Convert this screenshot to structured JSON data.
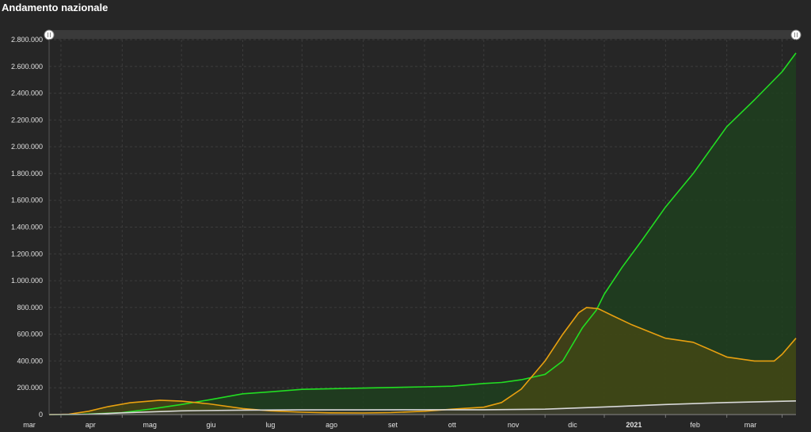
{
  "title": "Andamento nazionale",
  "chart_data": {
    "type": "area",
    "title": "Andamento nazionale",
    "xlabel": "",
    "ylabel": "",
    "x_start": "2020-02-24",
    "x_end": "2021-03-08",
    "ylim": [
      0,
      2800000
    ],
    "y_ticks": [
      0,
      200000,
      400000,
      600000,
      800000,
      1000000,
      1200000,
      1400000,
      1600000,
      1800000,
      2000000,
      2200000,
      2400000,
      2600000,
      2800000
    ],
    "y_tick_labels": [
      "0",
      "200.000",
      "400.000",
      "600.000",
      "800.000",
      "1.000.000",
      "1.200.000",
      "1.400.000",
      "1.600.000",
      "1.800.000",
      "2.000.000",
      "2.200.000",
      "2.400.000",
      "2.600.000",
      "2.800.000"
    ],
    "x_ticks": [
      {
        "date": "2020-03-01",
        "label": "mar",
        "bold": false
      },
      {
        "date": "2020-04-01",
        "label": "apr",
        "bold": false
      },
      {
        "date": "2020-05-01",
        "label": "mag",
        "bold": false
      },
      {
        "date": "2020-06-01",
        "label": "giu",
        "bold": false
      },
      {
        "date": "2020-07-01",
        "label": "lug",
        "bold": false
      },
      {
        "date": "2020-08-01",
        "label": "ago",
        "bold": false
      },
      {
        "date": "2020-09-01",
        "label": "set",
        "bold": false
      },
      {
        "date": "2020-10-01",
        "label": "ott",
        "bold": false
      },
      {
        "date": "2020-11-01",
        "label": "nov",
        "bold": false
      },
      {
        "date": "2020-12-01",
        "label": "dic",
        "bold": false
      },
      {
        "date": "2021-01-01",
        "label": "2021",
        "bold": true
      },
      {
        "date": "2021-02-01",
        "label": "feb",
        "bold": false
      },
      {
        "date": "2021-03-01",
        "label": "mar",
        "bold": false
      }
    ],
    "grid": true,
    "series": [
      {
        "color": "#22dd22",
        "fill": "#1f3f1f",
        "points": [
          [
            "2020-02-24",
            0
          ],
          [
            "2020-03-10",
            1000
          ],
          [
            "2020-03-25",
            10000
          ],
          [
            "2020-04-01",
            15000
          ],
          [
            "2020-04-15",
            40000
          ],
          [
            "2020-05-01",
            75000
          ],
          [
            "2020-05-15",
            110000
          ],
          [
            "2020-06-01",
            155000
          ],
          [
            "2020-06-15",
            170000
          ],
          [
            "2020-07-01",
            188000
          ],
          [
            "2020-08-01",
            198000
          ],
          [
            "2020-09-01",
            207000
          ],
          [
            "2020-09-15",
            212000
          ],
          [
            "2020-10-01",
            232000
          ],
          [
            "2020-10-10",
            240000
          ],
          [
            "2020-10-20",
            260000
          ],
          [
            "2020-11-01",
            300000
          ],
          [
            "2020-11-10",
            400000
          ],
          [
            "2020-11-20",
            650000
          ],
          [
            "2020-11-27",
            780000
          ],
          [
            "2020-12-01",
            900000
          ],
          [
            "2020-12-10",
            1100000
          ],
          [
            "2020-12-20",
            1300000
          ],
          [
            "2021-01-01",
            1550000
          ],
          [
            "2021-01-15",
            1800000
          ],
          [
            "2021-02-01",
            2150000
          ],
          [
            "2021-02-15",
            2350000
          ],
          [
            "2021-03-01",
            2560000
          ],
          [
            "2021-03-08",
            2700000
          ]
        ]
      },
      {
        "color": "#e8a010",
        "fill": "#4a4a12",
        "points": [
          [
            "2020-02-24",
            0
          ],
          [
            "2020-03-05",
            3000
          ],
          [
            "2020-03-15",
            25000
          ],
          [
            "2020-03-25",
            60000
          ],
          [
            "2020-04-05",
            88000
          ],
          [
            "2020-04-20",
            107000
          ],
          [
            "2020-05-01",
            100000
          ],
          [
            "2020-05-15",
            80000
          ],
          [
            "2020-06-01",
            45000
          ],
          [
            "2020-06-15",
            28000
          ],
          [
            "2020-07-01",
            18000
          ],
          [
            "2020-07-15",
            13000
          ],
          [
            "2020-08-01",
            12000
          ],
          [
            "2020-08-15",
            15000
          ],
          [
            "2020-09-01",
            25000
          ],
          [
            "2020-09-15",
            40000
          ],
          [
            "2020-10-01",
            55000
          ],
          [
            "2020-10-10",
            90000
          ],
          [
            "2020-10-20",
            190000
          ],
          [
            "2020-11-01",
            400000
          ],
          [
            "2020-11-10",
            600000
          ],
          [
            "2020-11-18",
            760000
          ],
          [
            "2020-11-22",
            800000
          ],
          [
            "2020-11-28",
            790000
          ],
          [
            "2020-12-05",
            740000
          ],
          [
            "2020-12-15",
            670000
          ],
          [
            "2021-01-01",
            570000
          ],
          [
            "2021-01-15",
            540000
          ],
          [
            "2021-02-01",
            430000
          ],
          [
            "2021-02-15",
            400000
          ],
          [
            "2021-02-25",
            400000
          ],
          [
            "2021-03-01",
            450000
          ],
          [
            "2021-03-08",
            570000
          ]
        ]
      },
      {
        "color": "#d8d8d8",
        "fill": "#3a3a36",
        "points": [
          [
            "2020-02-24",
            0
          ],
          [
            "2020-03-15",
            2000
          ],
          [
            "2020-04-01",
            13000
          ],
          [
            "2020-05-01",
            28000
          ],
          [
            "2020-06-01",
            33000
          ],
          [
            "2020-07-01",
            35000
          ],
          [
            "2020-08-01",
            35000
          ],
          [
            "2020-09-01",
            36000
          ],
          [
            "2020-10-01",
            36000
          ],
          [
            "2020-11-01",
            40000
          ],
          [
            "2020-12-01",
            57000
          ],
          [
            "2021-01-01",
            75000
          ],
          [
            "2021-02-01",
            90000
          ],
          [
            "2021-03-08",
            102000
          ]
        ]
      }
    ]
  }
}
